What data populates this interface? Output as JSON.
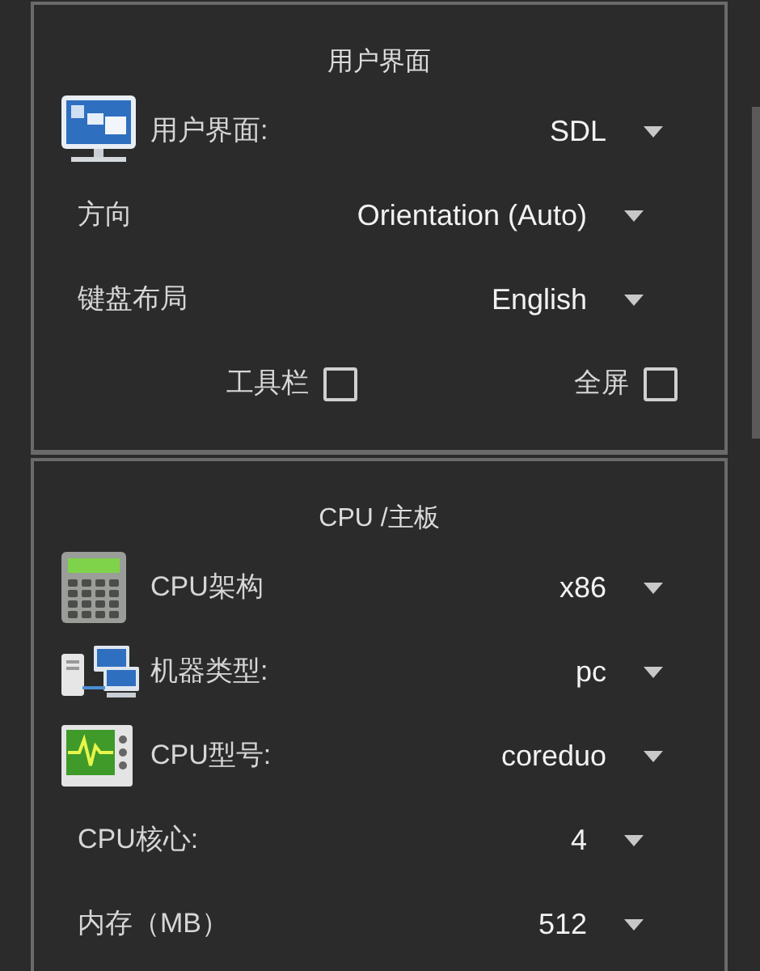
{
  "sections": [
    {
      "title": "用户界面",
      "rows": [
        {
          "kind": "display",
          "label": "用户界面:",
          "value": "SDL"
        },
        {
          "kind": "select",
          "label": "方向",
          "value": "Orientation (Auto)"
        },
        {
          "kind": "select",
          "label": "键盘布局",
          "value": "English"
        },
        {
          "kind": "checkboxes",
          "options": [
            {
              "label": "工具栏",
              "checked": false
            },
            {
              "label": "全屏",
              "checked": false
            }
          ]
        }
      ]
    },
    {
      "title": "CPU /主板",
      "rows": [
        {
          "kind": "calculator",
          "label": "CPU架构",
          "value": "x86"
        },
        {
          "kind": "computers",
          "label": "机器类型:",
          "value": "pc"
        },
        {
          "kind": "scope",
          "label": "CPU型号:",
          "value": "coreduo"
        },
        {
          "kind": "select",
          "label": "CPU核心:",
          "value": "4"
        },
        {
          "kind": "select",
          "label": "内存（MB）",
          "value": "512"
        }
      ]
    }
  ]
}
